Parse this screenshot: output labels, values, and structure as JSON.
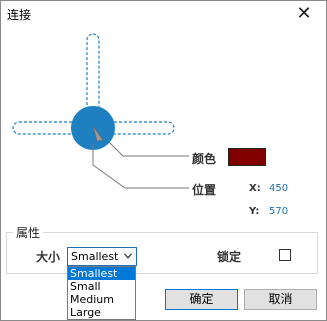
{
  "window": {
    "title": "连接",
    "close_glyph": "✕"
  },
  "diagram": {
    "accent_color": "#1e7fc1",
    "pointer_color": "#9a9a9a"
  },
  "color_field": {
    "label": "颜色",
    "value_color": "#800000"
  },
  "position_field": {
    "label": "位置",
    "x_label": "X:",
    "x_value": "450",
    "y_label": "Y:",
    "y_value": "570"
  },
  "properties": {
    "title": "属性",
    "size_label": "大小",
    "size_selected": "Smallest",
    "size_options": [
      "Smallest",
      "Small",
      "Medium",
      "Large"
    ],
    "lock_label": "锁定",
    "lock_checked": false
  },
  "buttons": {
    "ok": "确定",
    "cancel": "取消"
  },
  "icons": {
    "close": "close-icon",
    "dropdown": "chevron-down-icon",
    "pointer": "pointer-icon"
  }
}
